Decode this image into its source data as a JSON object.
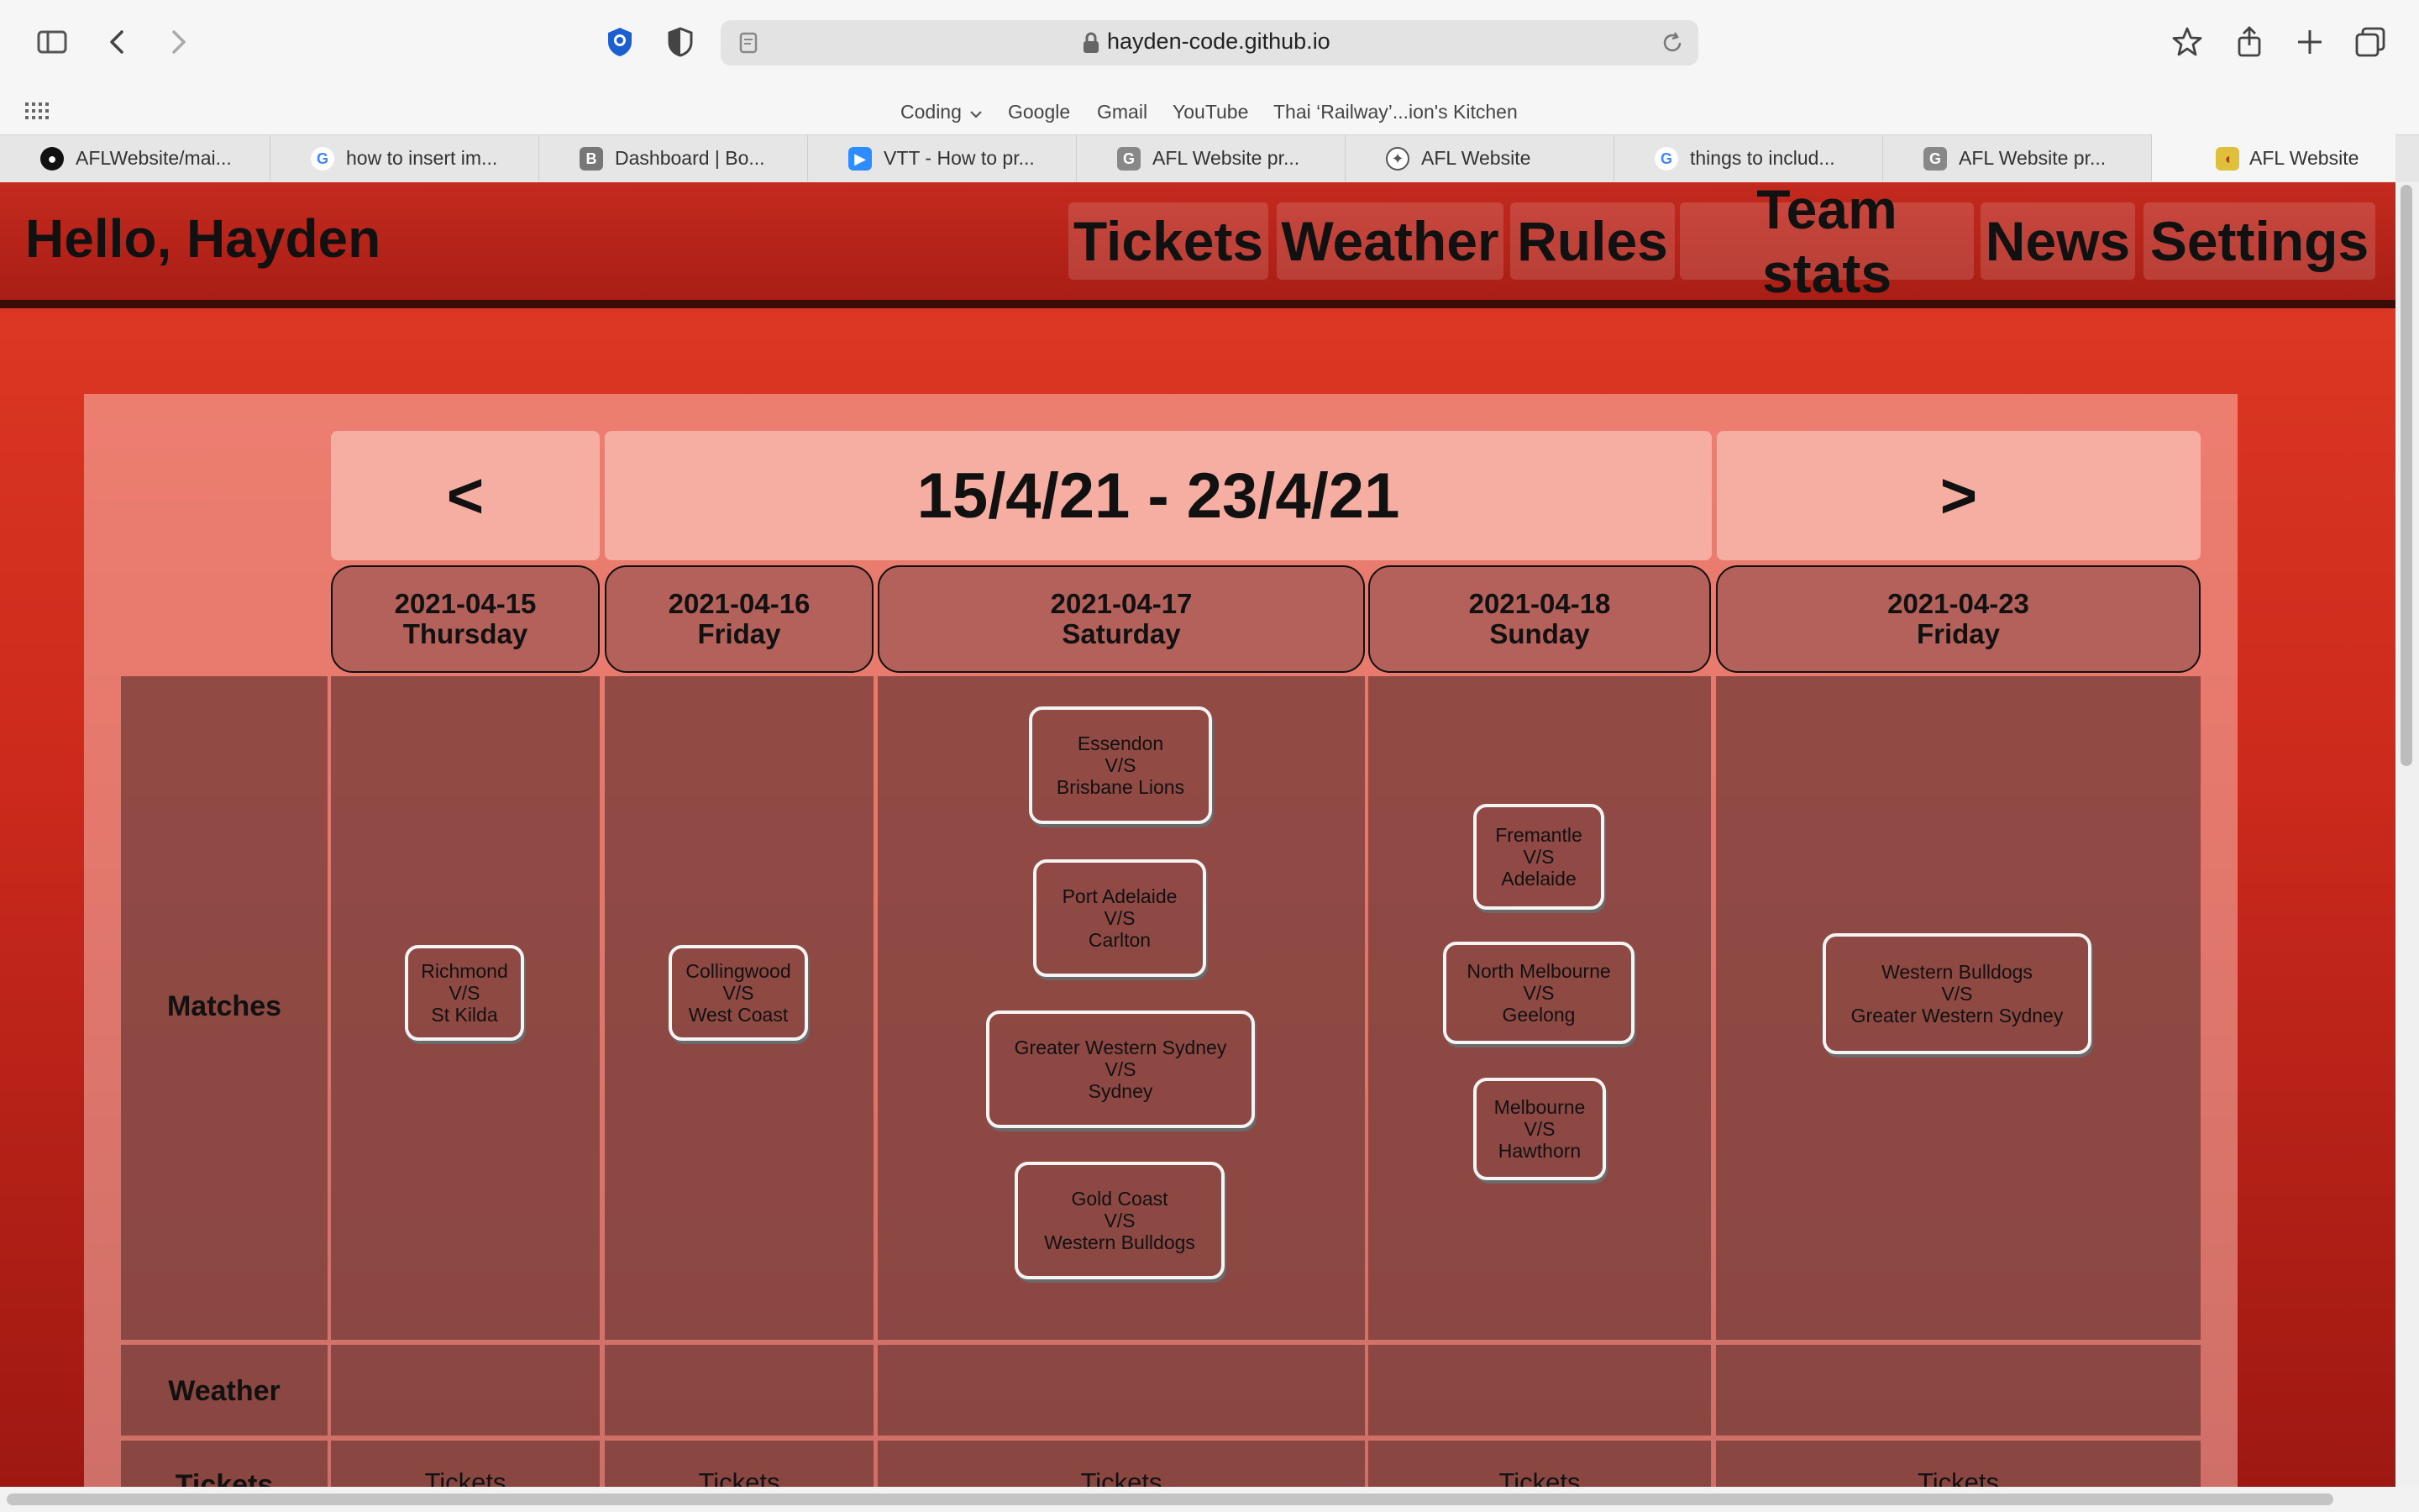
{
  "browser": {
    "url": "hayden-code.github.io",
    "favorites": [
      "Coding",
      "Google",
      "Gmail",
      "YouTube",
      "Thai ‘Railway’...ion's Kitchen"
    ],
    "tabs": [
      {
        "label": "AFLWebsite/mai...",
        "icon": "github-icon"
      },
      {
        "label": "how to insert im...",
        "icon": "google-icon"
      },
      {
        "label": "Dashboard | Bo...",
        "icon": "b-icon"
      },
      {
        "label": "VTT - How to pr...",
        "icon": "zoom-icon"
      },
      {
        "label": "AFL Website pr...",
        "icon": "g-icon"
      },
      {
        "label": "AFL Website",
        "icon": "compass-icon"
      },
      {
        "label": "things to includ...",
        "icon": "google-icon"
      },
      {
        "label": "AFL Website pr...",
        "icon": "g-icon"
      },
      {
        "label": "AFL Website",
        "icon": "football-icon"
      }
    ]
  },
  "header": {
    "greeting": "Hello, Hayden",
    "nav": [
      "Tickets",
      "Weather",
      "Rules",
      "Team stats",
      "News",
      "Settings"
    ]
  },
  "calendar": {
    "prev": "<",
    "next": ">",
    "range": "15/4/21 - 23/4/21",
    "days": [
      {
        "date": "2021-04-15",
        "weekday": "Thursday"
      },
      {
        "date": "2021-04-16",
        "weekday": "Friday"
      },
      {
        "date": "2021-04-17",
        "weekday": "Saturday"
      },
      {
        "date": "2021-04-18",
        "weekday": "Sunday"
      },
      {
        "date": "2021-04-23",
        "weekday": "Friday"
      }
    ],
    "rows": {
      "matches": "Matches",
      "weather": "Weather",
      "tickets": "Tickets"
    },
    "matches": [
      {
        "home": "Richmond",
        "vs": "V/S",
        "away": "St Kilda"
      },
      {
        "home": "Collingwood",
        "vs": "V/S",
        "away": "West Coast"
      },
      {
        "home": "Essendon",
        "vs": "V/S",
        "away": "Brisbane Lions"
      },
      {
        "home": "Port Adelaide",
        "vs": "V/S",
        "away": "Carlton"
      },
      {
        "home": "Greater Western Sydney",
        "vs": "V/S",
        "away": "Sydney"
      },
      {
        "home": "Gold Coast",
        "vs": "V/S",
        "away": "Western Bulldogs"
      },
      {
        "home": "Fremantle",
        "vs": "V/S",
        "away": "Adelaide"
      },
      {
        "home": "North Melbourne",
        "vs": "V/S",
        "away": "Geelong"
      },
      {
        "home": "Melbourne",
        "vs": "V/S",
        "away": "Hawthorn"
      },
      {
        "home": "Western Bulldogs",
        "vs": "V/S",
        "away": "Greater Western Sydney"
      }
    ],
    "ticket_label": "Tickets"
  }
}
